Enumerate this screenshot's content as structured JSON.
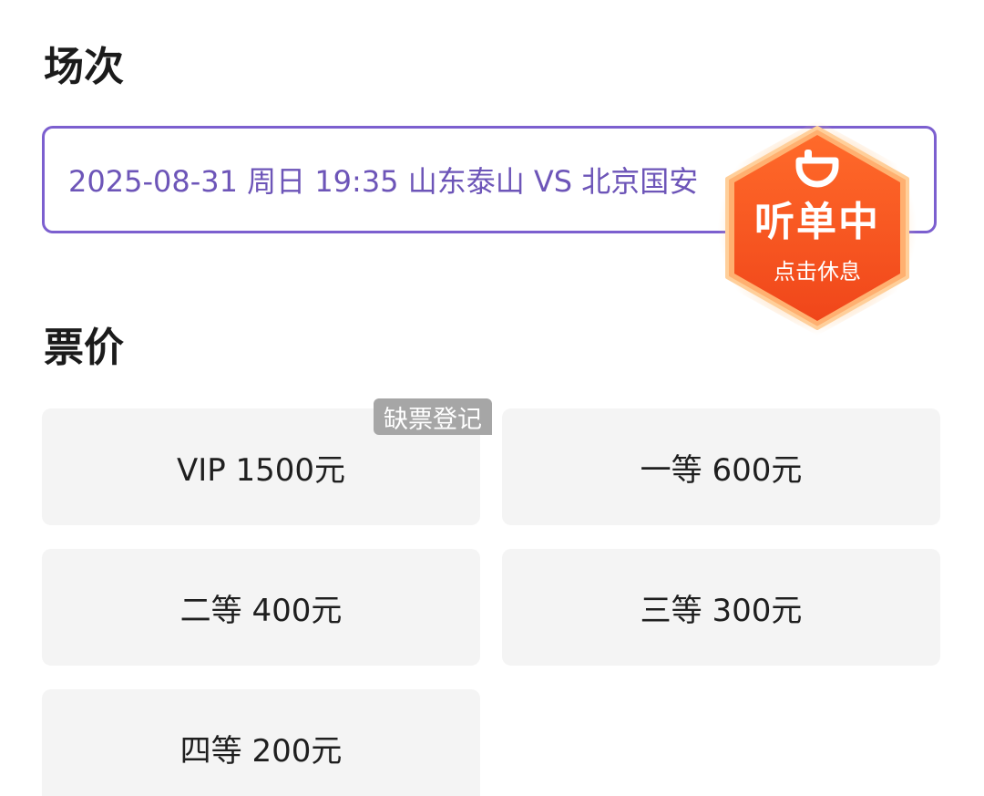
{
  "sections": {
    "session_title": "场次",
    "price_title": "票价"
  },
  "session": {
    "selected": "2025-08-31 周日 19:35 山东泰山 VS 北京国安"
  },
  "tickets": [
    {
      "label": "VIP 1500元",
      "tag": "缺票登记"
    },
    {
      "label": "一等 600元"
    },
    {
      "label": "二等 400元"
    },
    {
      "label": "三等 300元"
    },
    {
      "label": "四等 200元"
    }
  ],
  "badge": {
    "status": "听单中",
    "action": "点击休息",
    "icon": "didi-logo-icon"
  },
  "colors": {
    "accent": "#7c5fcf",
    "session_text": "#6d55b8",
    "badge_orange": "#fb5a1c",
    "tag_gray": "#a6a6a6",
    "card_bg": "#f4f4f4"
  }
}
